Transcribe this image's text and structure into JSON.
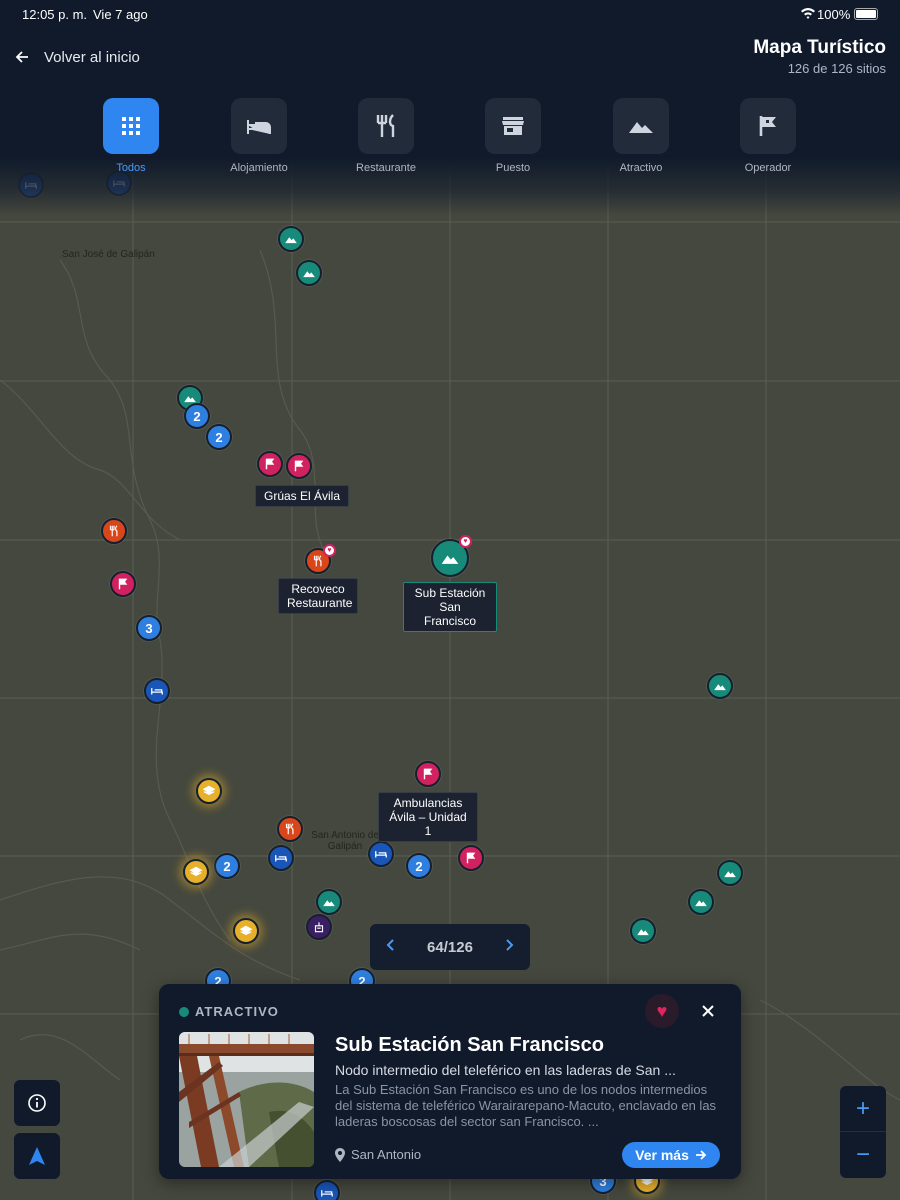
{
  "status": {
    "time": "12:05 p. m.",
    "date": "Vie 7 ago",
    "battery": "100%"
  },
  "header": {
    "back_label": "Volver al inicio",
    "title": "Mapa Turístico",
    "count": "126 de 126 sitios"
  },
  "filters": [
    {
      "label": "Todos",
      "icon": "grid-icon",
      "active": true
    },
    {
      "label": "Alojamiento",
      "icon": "bed-icon",
      "active": false
    },
    {
      "label": "Restaurante",
      "icon": "restaurant-icon",
      "active": false
    },
    {
      "label": "Puesto",
      "icon": "store-icon",
      "active": false
    },
    {
      "label": "Atractivo",
      "icon": "mountain-icon",
      "active": false
    },
    {
      "label": "Operador",
      "icon": "flag-icon",
      "active": false
    }
  ],
  "map": {
    "places": [
      "San José de Galipán",
      "San Antonio de Galipán"
    ],
    "tags": {
      "gruas": "Grúas El Ávila",
      "recoveco": "Recoveco Restaurante",
      "subestacion": "Sub Estación San Francisco",
      "ambulancias": "Ambulancias Ávila – Unidad 1"
    },
    "clusters": [
      "3",
      "2",
      "2",
      "3",
      "2",
      "2",
      "2",
      "2",
      "3"
    ]
  },
  "pager": {
    "current": "64/126"
  },
  "card": {
    "category": "ATRACTIVO",
    "title": "Sub Estación San Francisco",
    "subtitle": "Nodo intermedio del teleférico en las laderas de San ...",
    "description": "La Sub Estación San Francisco es uno de los nodos intermedios del sistema de teleférico Warairarepano-Macuto, enclavado en las laderas boscosas del sector san Francisco. ...",
    "location": "San Antonio",
    "more_label": "Ver más"
  },
  "controls": {
    "zoom_in": "+",
    "zoom_out": "−"
  },
  "colors": {
    "accent": "#2f86f0",
    "attraction": "#178a7a",
    "operator": "#d1225f",
    "restaurant": "#d8461a",
    "lodging": "#1a56b8",
    "panel": "#101a2b"
  }
}
